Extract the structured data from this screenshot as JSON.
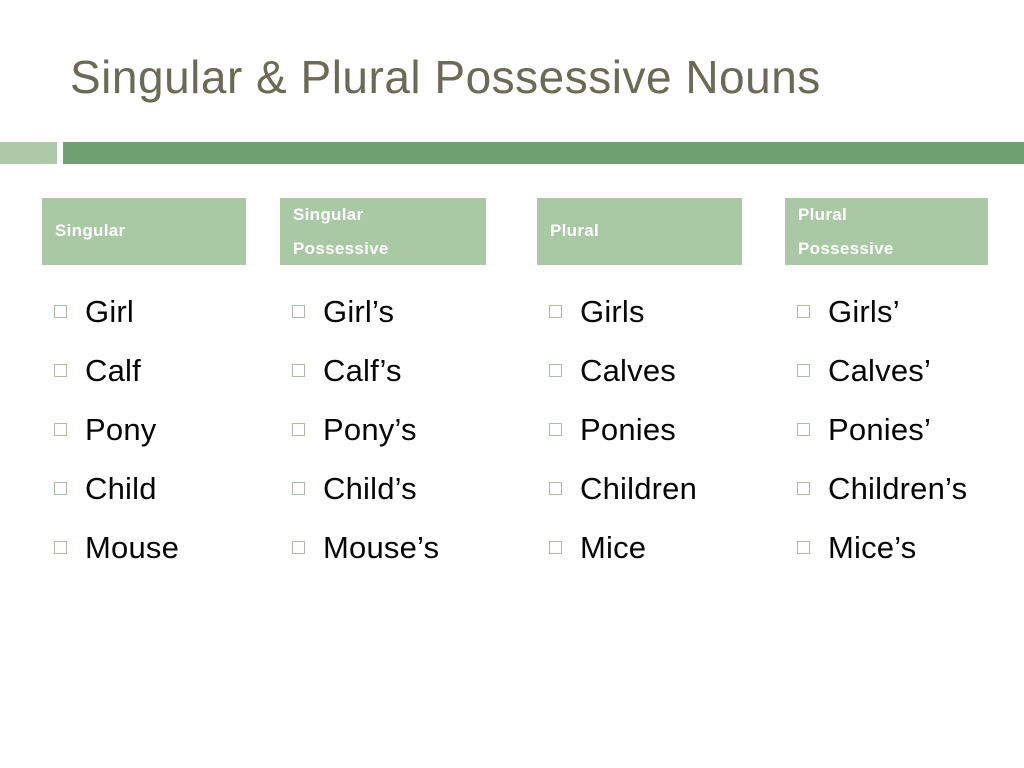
{
  "slide": {
    "title": "Singular & Plural Possessive Nouns",
    "title_color": "#6b6b55",
    "background_color": "#ffffff"
  },
  "divider": {
    "accent_color": "#adc9a8",
    "bar_color": "#6fa173"
  },
  "table": {
    "header_background": "#a9c8a4",
    "header_text_color": "#ffffff",
    "bullet_icon": "hollow-square",
    "bullet_color": "#a9bca8",
    "columns": [
      {
        "header_lines": [
          "Singular"
        ],
        "items": [
          "Girl",
          "Calf",
          "Pony",
          "Child",
          "Mouse"
        ]
      },
      {
        "header_lines": [
          "Singular",
          "Possessive"
        ],
        "items": [
          "Girl’s",
          "Calf’s",
          "Pony’s",
          "Child’s",
          "Mouse’s"
        ]
      },
      {
        "header_lines": [
          "Plural"
        ],
        "items": [
          "Girls",
          "Calves",
          "Ponies",
          "Children",
          "Mice"
        ]
      },
      {
        "header_lines": [
          "Plural",
          "Possessive"
        ],
        "items": [
          "Girls’",
          "Calves’",
          "Ponies’",
          "Children’s",
          "Mice’s"
        ]
      }
    ]
  }
}
